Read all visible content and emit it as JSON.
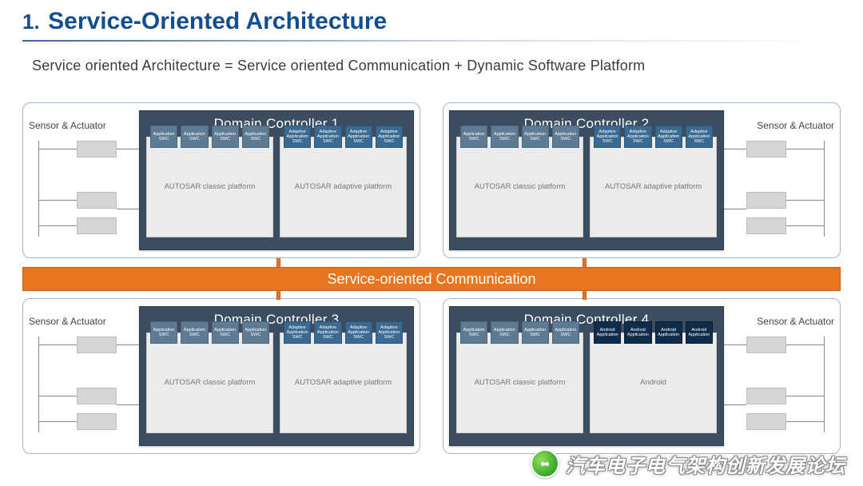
{
  "section_number": "1.",
  "section_title": "Service-Oriented Architecture",
  "equation_text": "Service oriented Architecture = Service oriented Communication + Dynamic Software Platform",
  "sensor_actuator_label": "Sensor & Actuator",
  "bus_label": "Service-oriented Communication",
  "controllers": [
    {
      "title": "Domain Controller 1",
      "sa_side": "left",
      "platforms": [
        {
          "label": "AUTOSAR classic platform",
          "swc_style": "classic",
          "swc": [
            "Application SWC",
            "Application SWC",
            "Application SWC",
            "Application SWC"
          ]
        },
        {
          "label": "AUTOSAR adaptive platform",
          "swc_style": "adaptive",
          "swc": [
            "Adaptive Application SWC",
            "Adaptive Application SWC",
            "Adaptive Application SWC",
            "Adaptive Application SWC"
          ]
        }
      ]
    },
    {
      "title": "Domain Controller 2",
      "sa_side": "right",
      "platforms": [
        {
          "label": "AUTOSAR classic platform",
          "swc_style": "classic",
          "swc": [
            "Application SWC",
            "Application SWC",
            "Application SWC",
            "Application SWC"
          ]
        },
        {
          "label": "AUTOSAR adaptive platform",
          "swc_style": "adaptive",
          "swc": [
            "Adaptive Application SWC",
            "Adaptive Application SWC",
            "Adaptive Application SWC",
            "Adaptive Application SWC"
          ]
        }
      ]
    },
    {
      "title": "Domain Controller 3",
      "sa_side": "left",
      "platforms": [
        {
          "label": "AUTOSAR classic platform",
          "swc_style": "classic",
          "swc": [
            "Application SWC",
            "Application SWC",
            "Application SWC",
            "Application SWC"
          ]
        },
        {
          "label": "AUTOSAR adaptive platform",
          "swc_style": "adaptive",
          "swc": [
            "Adaptive Application SWC",
            "Adaptive Application SWC",
            "Adaptive Application SWC",
            "Adaptive Application SWC"
          ]
        }
      ]
    },
    {
      "title": "Domain Controller 4",
      "sa_side": "right",
      "platforms": [
        {
          "label": "AUTOSAR classic platform",
          "swc_style": "classic",
          "swc": [
            "Application SWC",
            "Application SWC",
            "Application SWC",
            "Application SWC"
          ]
        },
        {
          "label": "Android",
          "swc_style": "android",
          "swc": [
            "Android Application",
            "Android Application",
            "Android Application",
            "Android Application"
          ]
        }
      ]
    }
  ],
  "watermark_text": "汽车电子电气架构创新发展论坛"
}
